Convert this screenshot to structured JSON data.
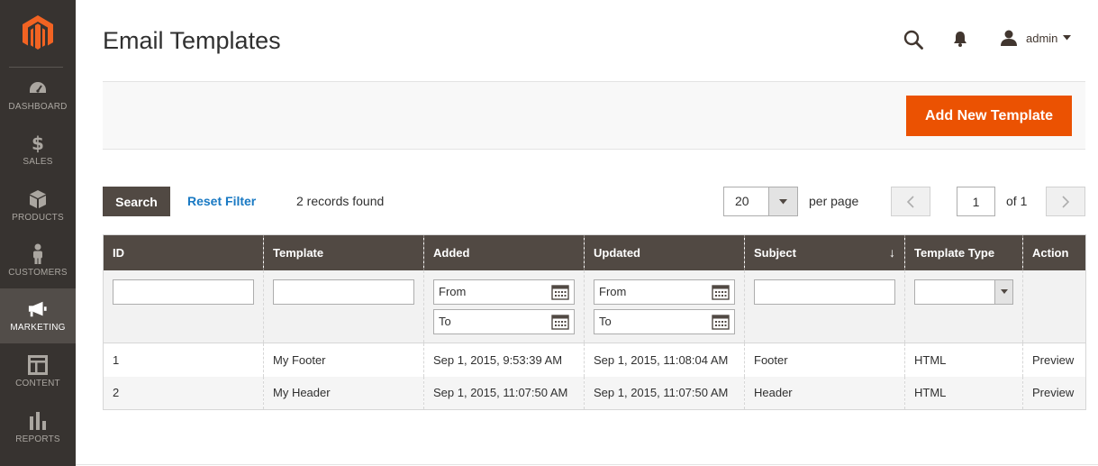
{
  "page": {
    "title": "Email Templates"
  },
  "header": {
    "user_name": "admin"
  },
  "sidebar": {
    "items": [
      {
        "label": "DASHBOARD",
        "icon": "dashboard-icon"
      },
      {
        "label": "SALES",
        "icon": "dollar-icon"
      },
      {
        "label": "PRODUCTS",
        "icon": "box-icon"
      },
      {
        "label": "CUSTOMERS",
        "icon": "person-icon"
      },
      {
        "label": "MARKETING",
        "icon": "megaphone-icon",
        "active": true
      },
      {
        "label": "CONTENT",
        "icon": "layout-icon"
      },
      {
        "label": "REPORTS",
        "icon": "bar-chart-icon"
      }
    ]
  },
  "actions": {
    "add_label": "Add New Template"
  },
  "toolbar": {
    "search_label": "Search",
    "reset_label": "Reset Filter",
    "records_text": "2 records found",
    "per_page_value": "20",
    "per_page_label": "per page",
    "current_page": "1",
    "page_of": "of 1"
  },
  "grid": {
    "columns": [
      "ID",
      "Template",
      "Added",
      "Updated",
      "Subject",
      "Template Type",
      "Action"
    ],
    "filters": {
      "from_text": "From",
      "to_text": "To"
    },
    "rows": [
      {
        "id": "1",
        "template": "My Footer",
        "added": "Sep 1, 2015, 9:53:39 AM",
        "updated": "Sep 1, 2015, 11:08:04 AM",
        "subject": "Footer",
        "type": "HTML",
        "action": "Preview"
      },
      {
        "id": "2",
        "template": "My Header",
        "added": "Sep 1, 2015, 11:07:50 AM",
        "updated": "Sep 1, 2015, 11:07:50 AM",
        "subject": "Header",
        "type": "HTML",
        "action": "Preview"
      }
    ]
  },
  "colors": {
    "accent": "#eb5202",
    "sidebar": "#373330",
    "grid_header": "#514943",
    "link": "#1979c3"
  }
}
